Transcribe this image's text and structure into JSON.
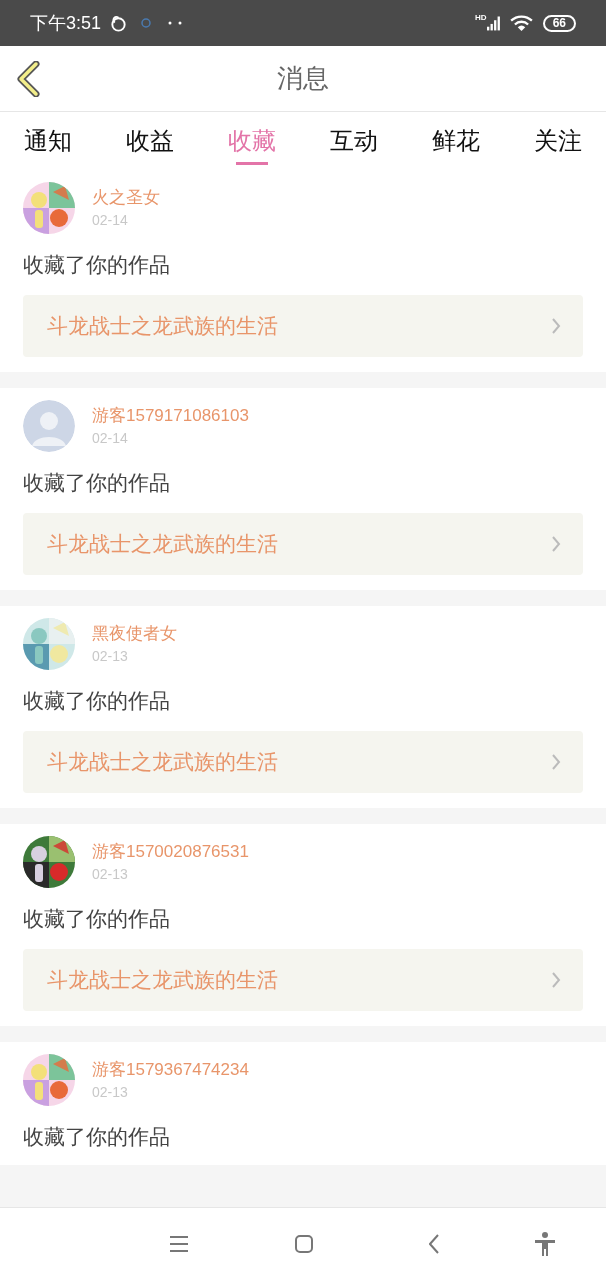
{
  "status_bar": {
    "time": "下午3:51",
    "network": "HD",
    "battery": "66"
  },
  "header": {
    "title": "消息"
  },
  "tabs": [
    {
      "label": "通知",
      "selected": false
    },
    {
      "label": "收益",
      "selected": false
    },
    {
      "label": "收藏",
      "selected": true
    },
    {
      "label": "互动",
      "selected": false
    },
    {
      "label": "鲜花",
      "selected": false
    },
    {
      "label": "关注",
      "selected": false
    }
  ],
  "messages": [
    {
      "name": "火之圣女",
      "date": "02-14",
      "text": "收藏了你的作品",
      "work": "斗龙战士之龙武族的生活"
    },
    {
      "avatar": {
        "kind": "default"
      },
      "name": "游客1579171086103",
      "date": "02-14",
      "text": "收藏了你的作品",
      "work": "斗龙战士之龙武族的生活"
    },
    {
      "name": "黑夜使者女",
      "date": "02-13",
      "text": "收藏了你的作品",
      "work": "斗龙战士之龙武族的生活"
    },
    {
      "name": "游客1570020876531",
      "date": "02-13",
      "text": "收藏了你的作品",
      "work": "斗龙战士之龙武族的生活"
    },
    {
      "name": "游客1579367474234",
      "date": "02-13",
      "text": "收藏了你的作品"
    }
  ]
}
